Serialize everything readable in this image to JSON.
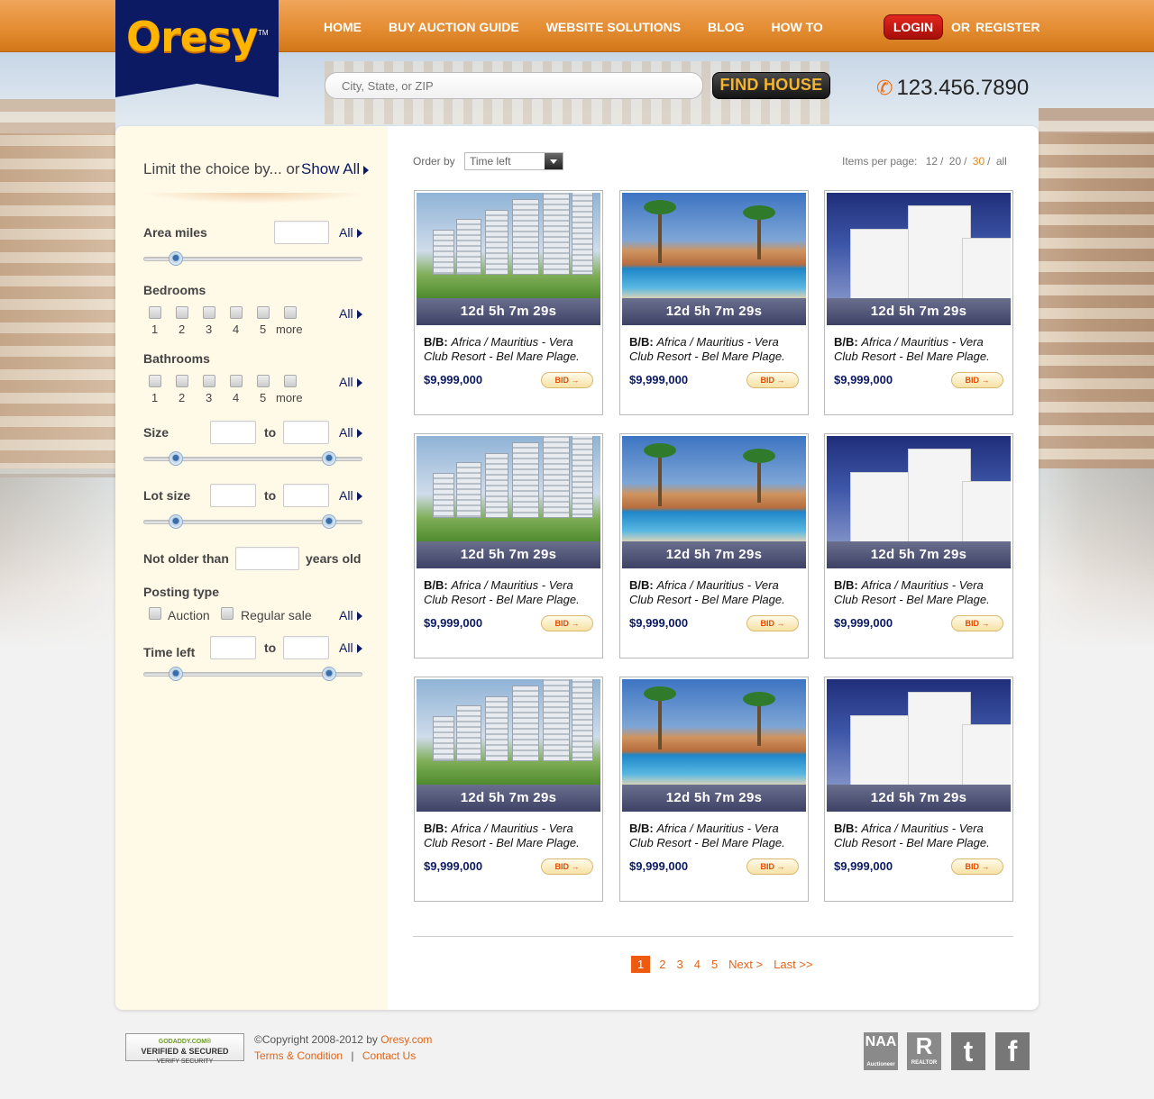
{
  "brand": {
    "name": "Oresy",
    "tm": "TM",
    "accent": "#e48d33",
    "navy": "#0b1a63"
  },
  "nav": {
    "items": [
      "HOME",
      "BUY AUCTION GUIDE",
      "WEBSITE SOLUTIONS",
      "BLOG",
      "HOW TO"
    ]
  },
  "auth": {
    "login": "LOGIN",
    "or": "OR",
    "register": "REGISTER"
  },
  "search": {
    "placeholder": "City, State, or ZIP",
    "button": "FIND HOUSE"
  },
  "phone": {
    "icon": "phone-icon",
    "number": "123.456.7890"
  },
  "sidebar": {
    "heading": "Limit the choice by... or",
    "show_all": "Show All",
    "area_miles": "Area miles",
    "bedrooms": "Bedrooms",
    "bathrooms": "Bathrooms",
    "room_options": [
      "1",
      "2",
      "3",
      "4",
      "5",
      "more"
    ],
    "size": "Size",
    "lot_size": "Lot size",
    "to": "to",
    "not_older": "Not older than",
    "years_old": "years old",
    "posting_type": "Posting type",
    "auction": "Auction",
    "regular_sale": "Regular sale",
    "time_left": "Time left",
    "all": "All"
  },
  "toolbar": {
    "order_by": "Order by",
    "order_value": "Time left",
    "items_per_page": "Items per page:",
    "ipp_options": [
      "12",
      "20",
      "30",
      "all"
    ],
    "ipp_active": "30"
  },
  "listings": [
    {
      "timer": "12d  5h  7m  29s",
      "type": "B/B:",
      "title": "Africa / Mauritius - Vera Club Resort - Bel Mare Plage.",
      "price": "$9,999,000",
      "bid": "BID →"
    },
    {
      "timer": "12d  5h  7m  29s",
      "type": "B/B:",
      "title": "Africa / Mauritius - Vera Club Resort - Bel Mare Plage.",
      "price": "$9,999,000",
      "bid": "BID →"
    },
    {
      "timer": "12d  5h  7m  29s",
      "type": "B/B:",
      "title": "Africa / Mauritius - Vera Club Resort - Bel Mare Plage.",
      "price": "$9,999,000",
      "bid": "BID →"
    },
    {
      "timer": "12d  5h  7m  29s",
      "type": "B/B:",
      "title": "Africa / Mauritius - Vera Club Resort - Bel Mare Plage.",
      "price": "$9,999,000",
      "bid": "BID →"
    },
    {
      "timer": "12d  5h  7m  29s",
      "type": "B/B:",
      "title": "Africa / Mauritius - Vera Club Resort - Bel Mare Plage.",
      "price": "$9,999,000",
      "bid": "BID →"
    },
    {
      "timer": "12d  5h  7m  29s",
      "type": "B/B:",
      "title": "Africa / Mauritius - Vera Club Resort - Bel Mare Plage.",
      "price": "$9,999,000",
      "bid": "BID →"
    },
    {
      "timer": "12d  5h  7m  29s",
      "type": "B/B:",
      "title": "Africa / Mauritius - Vera Club Resort - Bel Mare Plage.",
      "price": "$9,999,000",
      "bid": "BID →"
    },
    {
      "timer": "12d  5h  7m  29s",
      "type": "B/B:",
      "title": "Africa / Mauritius - Vera Club Resort - Bel Mare Plage.",
      "price": "$9,999,000",
      "bid": "BID →"
    },
    {
      "timer": "12d  5h  7m  29s",
      "type": "B/B:",
      "title": "Africa / Mauritius - Vera Club Resort - Bel Mare Plage.",
      "price": "$9,999,000",
      "bid": "BID →"
    }
  ],
  "pagination": {
    "current": "1",
    "pages": [
      "2",
      "3",
      "4",
      "5"
    ],
    "next": "Next >",
    "last": "Last >>"
  },
  "footer": {
    "badge_top": "GODADDY.COM®",
    "badge_mid": "VERIFIED & SECURED",
    "badge_bot": "VERIFY SECURITY",
    "copyright_prefix": "©Copyright 2008-2012 by ",
    "copyright_link": "Oresy.com",
    "terms": "Terms & Condition",
    "sep": "|",
    "contact": "Contact Us",
    "naa_title": "NAA",
    "naa_sub": "Auctioneer",
    "realtor_mark": "R",
    "realtor_sub": "REALTOR",
    "twitter_glyph": "t",
    "facebook_glyph": "f"
  }
}
